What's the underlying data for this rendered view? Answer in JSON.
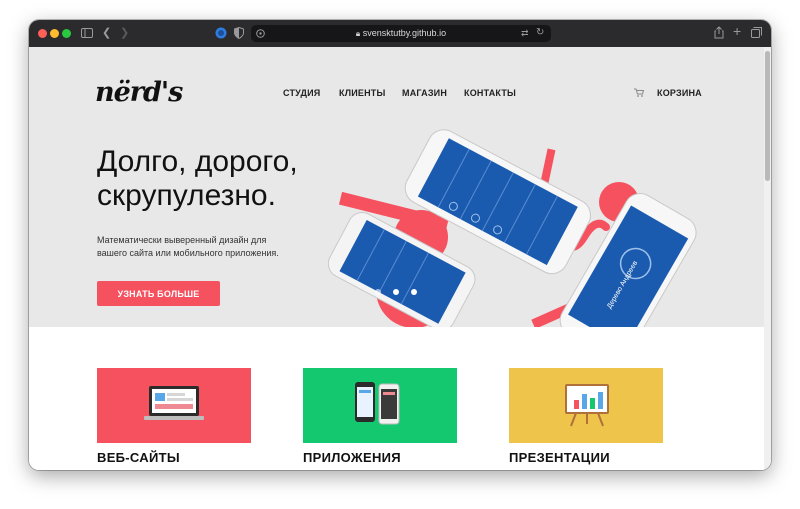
{
  "browser": {
    "url": "svensktutby.github.io"
  },
  "site": {
    "logo": "nërd's",
    "nav": [
      "СТУДИЯ",
      "КЛИЕНТЫ",
      "МАГАЗИН",
      "КОНТАКТЫ"
    ],
    "cart_label": "КОРЗИНА"
  },
  "hero": {
    "headline_line1": "Долго, дорого,",
    "headline_line2": "скрупулезно.",
    "subtext_line1": "Математически выверенный дизайн для",
    "subtext_line2": "вашего сайта или мобильного приложения.",
    "cta_label": "УЗНАТЬ БОЛЬШЕ",
    "phone_caption": "Дерево Андреев",
    "slider_dots": 3,
    "slider_active": 0
  },
  "services": [
    {
      "title": "ВЕБ-САЙТЫ",
      "color": "#f5515f",
      "icon": "laptop-icon"
    },
    {
      "title": "ПРИЛОЖЕНИЯ",
      "color": "#13c86f",
      "icon": "phones-icon"
    },
    {
      "title": "ПРЕЗЕНТАЦИИ",
      "color": "#eec54a",
      "icon": "presentation-board-icon"
    }
  ],
  "colors": {
    "accent": "#f5515f",
    "hero_bg": "#e8e8e8",
    "app_blue": "#1a5bb0"
  }
}
